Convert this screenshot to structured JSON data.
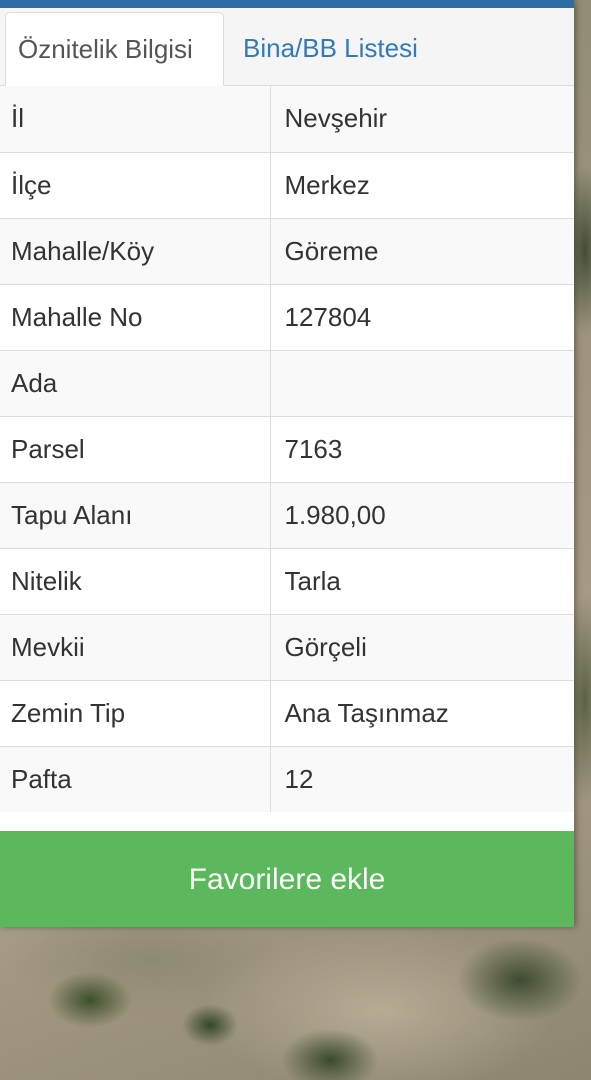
{
  "tabs": [
    {
      "label": "Öznitelik Bilgisi",
      "active": true
    },
    {
      "label": "Bina/BB Listesi",
      "active": false
    }
  ],
  "attributes": [
    {
      "key": "İl",
      "value": "Nevşehir"
    },
    {
      "key": "İlçe",
      "value": "Merkez"
    },
    {
      "key": "Mahalle/Köy",
      "value": "Göreme"
    },
    {
      "key": "Mahalle No",
      "value": "127804"
    },
    {
      "key": "Ada",
      "value": ""
    },
    {
      "key": "Parsel",
      "value": "7163"
    },
    {
      "key": "Tapu Alanı",
      "value": "1.980,00"
    },
    {
      "key": "Nitelik",
      "value": "Tarla"
    },
    {
      "key": "Mevkii",
      "value": "Görçeli"
    },
    {
      "key": "Zemin Tip",
      "value": "Ana Taşınmaz"
    },
    {
      "key": "Pafta",
      "value": "12"
    }
  ],
  "favorite_button_label": "Favorilere ekle",
  "colors": {
    "header_blue": "#2e6da4",
    "tab_link": "#337ab7",
    "button_green": "#5cb85c"
  }
}
